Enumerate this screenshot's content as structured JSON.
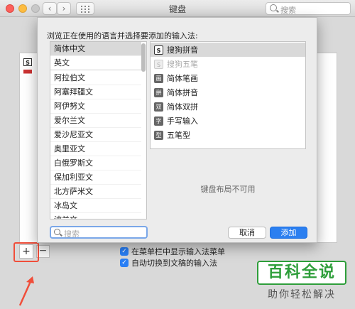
{
  "window": {
    "title": "键盘",
    "search_placeholder": "搜索"
  },
  "background": {
    "sources": [
      {
        "icon": "sogou-icon",
        "badge": "S"
      },
      {
        "icon": "us-flag-icon",
        "badge": ""
      }
    ],
    "add_label": "+",
    "remove_label": "−",
    "checkboxes": [
      {
        "label": "在菜单栏中显示输入法菜单",
        "checked": true
      },
      {
        "label": "自动切换到文稿的输入法",
        "checked": true
      }
    ]
  },
  "sheet": {
    "prompt": "浏览正在使用的语言并选择要添加的输入法:",
    "languages": [
      "简体中文",
      "英文",
      "阿拉伯文",
      "阿塞拜疆文",
      "阿伊努文",
      "爱尔兰文",
      "爱沙尼亚文",
      "奥里亚文",
      "白俄罗斯文",
      "保加利亚文",
      "北方萨米文",
      "冰岛文",
      "波兰文"
    ],
    "selected_language": "简体中文",
    "input_methods": [
      {
        "label": "搜狗拼音",
        "icon_text": "S",
        "icon": "sogou-icon",
        "selected": true,
        "dimmed": false
      },
      {
        "label": "搜狗五笔",
        "icon_text": "S",
        "icon": "sogou-icon",
        "selected": false,
        "dimmed": true
      },
      {
        "label": "简体笔画",
        "icon_text": "画",
        "icon": "stroke-icon",
        "selected": false,
        "dimmed": false
      },
      {
        "label": "简体拼音",
        "icon_text": "拼",
        "icon": "pinyin-icon",
        "selected": false,
        "dimmed": false
      },
      {
        "label": "简体双拼",
        "icon_text": "双",
        "icon": "shuangpin-icon",
        "selected": false,
        "dimmed": false
      },
      {
        "label": "手写输入",
        "icon_text": "字",
        "icon": "handwriting-icon",
        "selected": false,
        "dimmed": false
      },
      {
        "label": "五笔型",
        "icon_text": "型",
        "icon": "wubi-icon",
        "selected": false,
        "dimmed": false
      }
    ],
    "layout_unavailable": "键盘布局不可用",
    "search_placeholder": "搜索",
    "cancel_label": "取消",
    "add_label": "添加"
  },
  "watermark": {
    "title": "百科全说",
    "subtitle": "助你轻松解决"
  },
  "colors": {
    "accent": "#2b7ff0",
    "highlight": "#f04e3a",
    "watermark": "#2e9e3a"
  }
}
